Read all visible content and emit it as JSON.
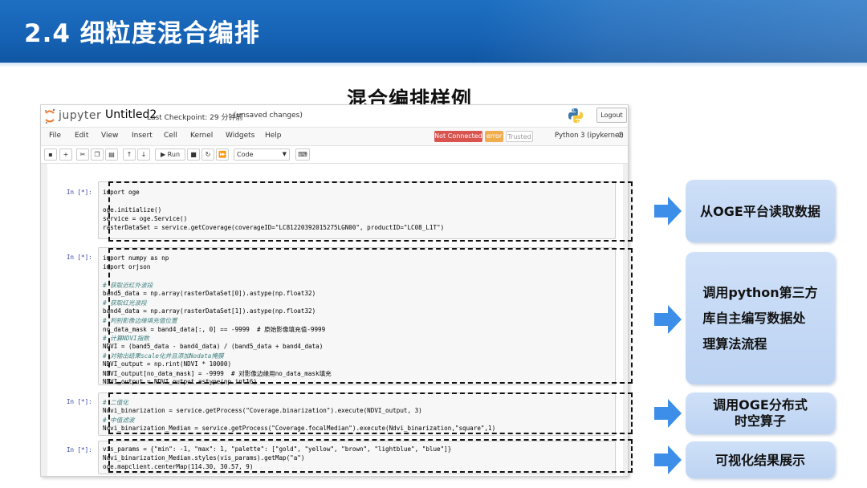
{
  "slide": {
    "title": "2.4 细粒度混合编排",
    "section_title": "混合编排样例"
  },
  "notebook": {
    "brand": "jupyter",
    "name": "Untitled2",
    "checkpoint": "Last Checkpoint: 29 分钟前",
    "unsaved": "(unsaved changes)",
    "logout_label": "Logout",
    "menu": [
      "File",
      "Edit",
      "View",
      "Insert",
      "Cell",
      "Kernel",
      "Widgets",
      "Help"
    ],
    "status": {
      "not_connected": "Not Connected",
      "error": "error",
      "trusted": "Trusted",
      "kernel": "Python 3 (ipykernel)"
    },
    "toolbar": {
      "run_label": "Run",
      "cell_type": "Code"
    },
    "cells": [
      {
        "prompt": "In  [*]:",
        "lines": [
          {
            "t": "import oge",
            "c": false
          },
          {
            "t": "",
            "c": false
          },
          {
            "t": "oge.initialize()",
            "c": false
          },
          {
            "t": "service = oge.Service()",
            "c": false
          },
          {
            "t": "rasterDataSet = service.getCoverage(coverageID=\"LC81220392015275LGN00\", productID=\"LC08_L1T\")",
            "c": false
          }
        ]
      },
      {
        "prompt": "In  [*]:",
        "lines": [
          {
            "t": "import numpy as np",
            "c": false
          },
          {
            "t": "import orjson",
            "c": false
          },
          {
            "t": "",
            "c": false
          },
          {
            "t": "# 获取近红外波段",
            "c": true
          },
          {
            "t": "band5_data = np.array(rasterDataSet[0]).astype(np.float32)",
            "c": false
          },
          {
            "t": "# 获取红光波段",
            "c": true
          },
          {
            "t": "band4_data = np.array(rasterDataSet[1]).astype(np.float32)",
            "c": false
          },
          {
            "t": "# 判别影像边缘填充值位置",
            "c": true
          },
          {
            "t": "no_data_mask = band4_data[:, 0] == -9999  # 原始影像填充值-9999",
            "c": false
          },
          {
            "t": "# 计算NDVI指数",
            "c": true
          },
          {
            "t": "NDVI = (band5_data - band4_data) / (band5_data + band4_data)",
            "c": false
          },
          {
            "t": "# 对输出结果scale化并且添加Nodata掩膜",
            "c": true
          },
          {
            "t": "NDVI_output = np.rint(NDVI * 10000)",
            "c": false
          },
          {
            "t": "NDVI_output[no_data_mask] = -9999  # 对影像边缘用no_data_mask填充",
            "c": false
          },
          {
            "t": "NDVI_output = NDVI_output.astype(np.int16)",
            "c": false
          }
        ]
      },
      {
        "prompt": "In  [*]:",
        "lines": [
          {
            "t": "# 二值化",
            "c": true
          },
          {
            "t": "Ndvi_binarization = service.getProcess(\"Coverage.binarization\").execute(NDVI_output, 3)",
            "c": false
          },
          {
            "t": "# 中值滤波",
            "c": true
          },
          {
            "t": "Ndvi_binarization_Median = service.getProcess(\"Coverage.focalMedian\").execute(Ndvi_binarization,\"square\",1)",
            "c": false
          }
        ]
      },
      {
        "prompt": "In  [*]:",
        "lines": [
          {
            "t": "vis_params = {\"min\": -1, \"max\": 1, \"palette\": [\"gold\", \"yellow\", \"brown\", \"lightblue\", \"blue\"]}",
            "c": false
          },
          {
            "t": "Ndvi_binarization_Median.styles(vis_params).getMap(\"a\")",
            "c": false
          },
          {
            "t": "oge.mapclient.centerMap(114.30, 30.57, 9)",
            "c": false
          }
        ]
      }
    ]
  },
  "callouts": [
    "从OGE平台读取数据",
    "调用python第三方\n库自主编写数据处\n理算法流程",
    "调用OGE分布式\n时空算子",
    "可视化结果展示"
  ],
  "colors": {
    "header_blue": "#1662b4",
    "arrow_blue": "#3d8ee8",
    "callout_bg": "#c6daf5",
    "code_comment": "#408080"
  }
}
